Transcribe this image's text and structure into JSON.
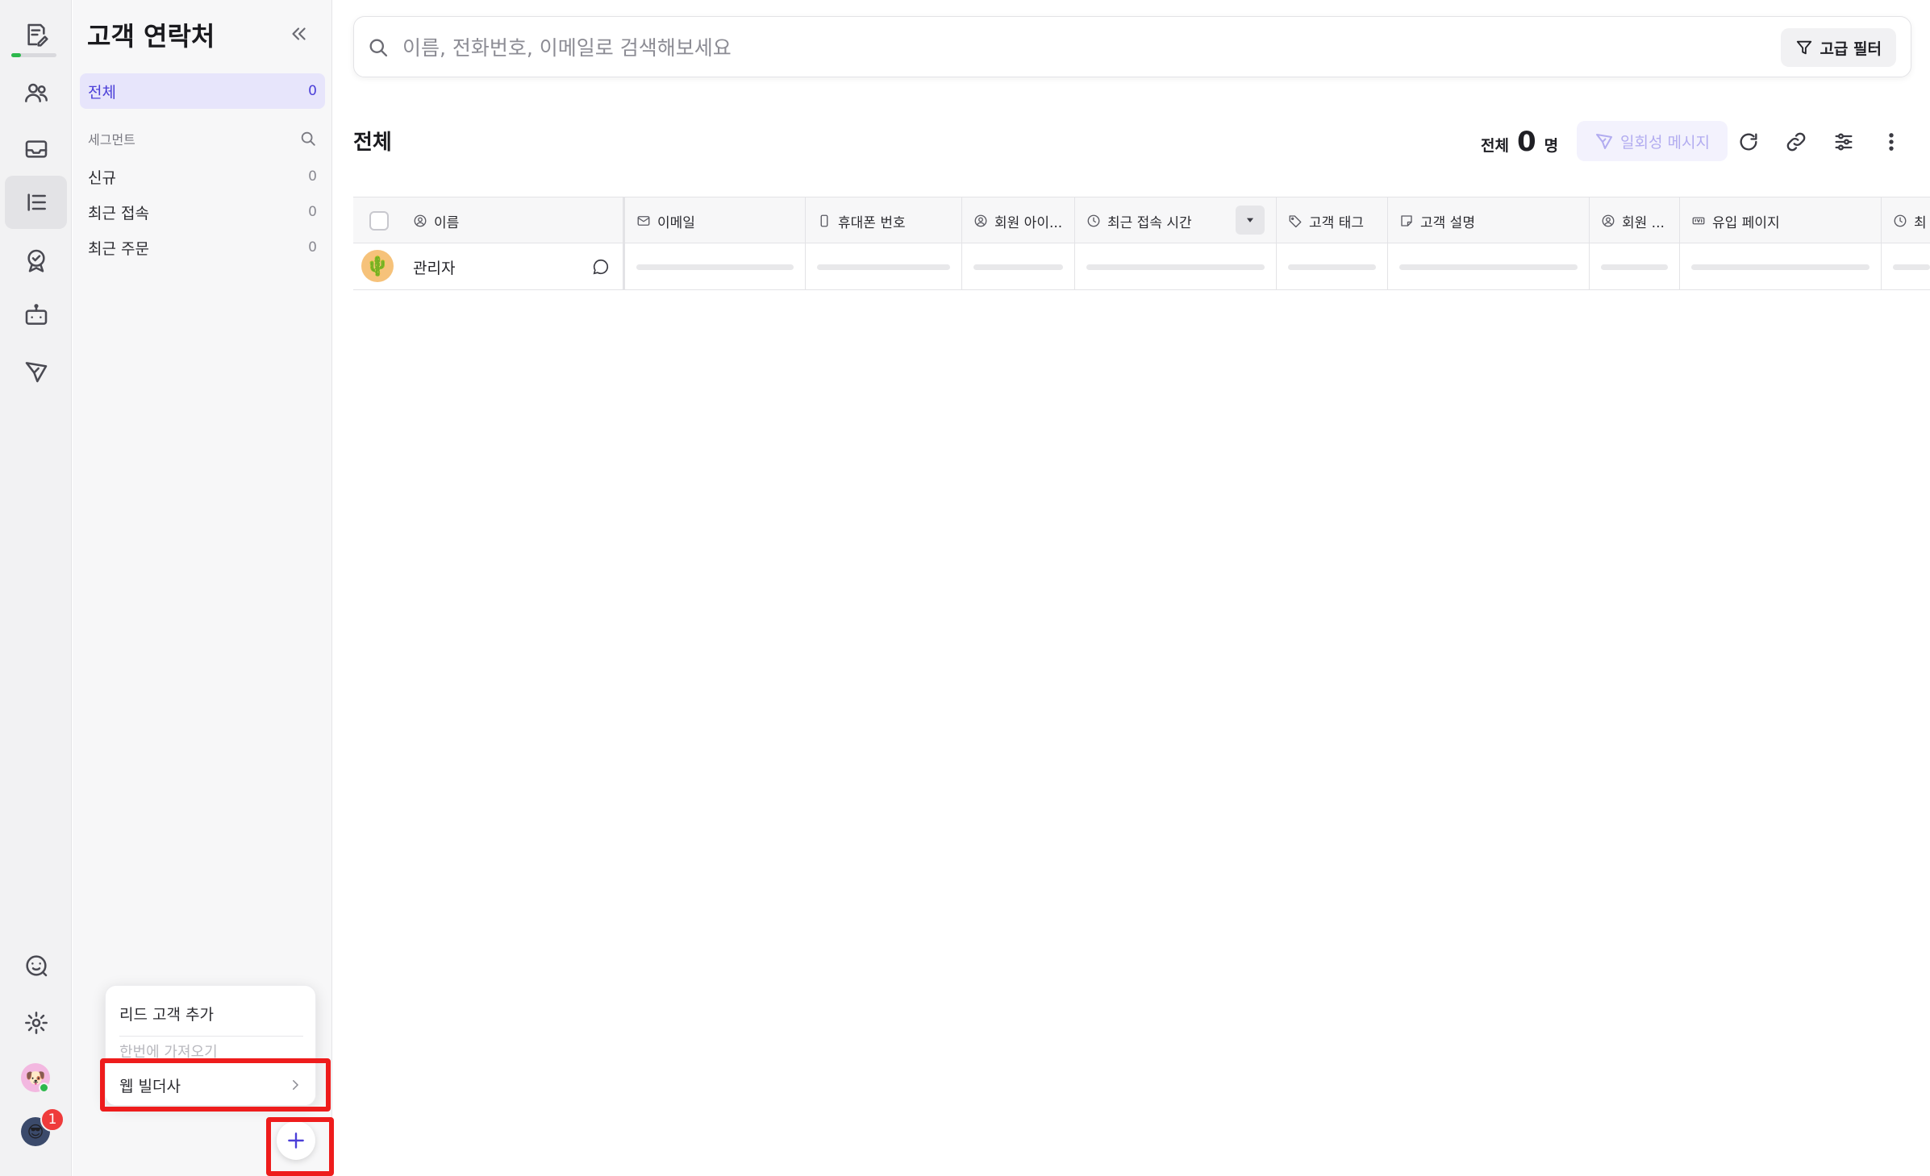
{
  "sidebar": {
    "title": "고객 연락처",
    "segments_header": "세그먼트",
    "items": [
      {
        "label": "전체",
        "count": "0"
      },
      {
        "label": "신규",
        "count": "0"
      },
      {
        "label": "최근 접속",
        "count": "0"
      },
      {
        "label": "최근 주문",
        "count": "0"
      }
    ]
  },
  "rail": {
    "badge_count": "1",
    "icons": [
      "notes-icon",
      "users-icon",
      "inbox-icon",
      "list-icon",
      "badge-check-icon",
      "bot-icon",
      "send-icon",
      "support-chat-icon",
      "gear-icon"
    ]
  },
  "popover": {
    "item_add_lead": "리드 고객 추가",
    "item_import_faded": "한번에 가져오기",
    "item_web_builder": "웹 빌더사"
  },
  "search": {
    "placeholder": "이름, 전화번호, 이메일로 검색해보세요",
    "advanced_filter": "고급 필터"
  },
  "main": {
    "title": "전체",
    "total_label": "전체",
    "total_count": "0",
    "total_unit": "명",
    "bulk_message": "일회성 메시지"
  },
  "table": {
    "columns": [
      "이름",
      "이메일",
      "휴대폰 번호",
      "회원 아이...",
      "최근 접속 시간",
      "고객 태그",
      "고객 설명",
      "회원 ...",
      "유입 페이지",
      "최"
    ],
    "rows": [
      {
        "name": "관리자"
      }
    ]
  },
  "colors": {
    "accent": "#4b3fd8",
    "highlight": "#ee1c1c",
    "online": "#2db84c"
  }
}
